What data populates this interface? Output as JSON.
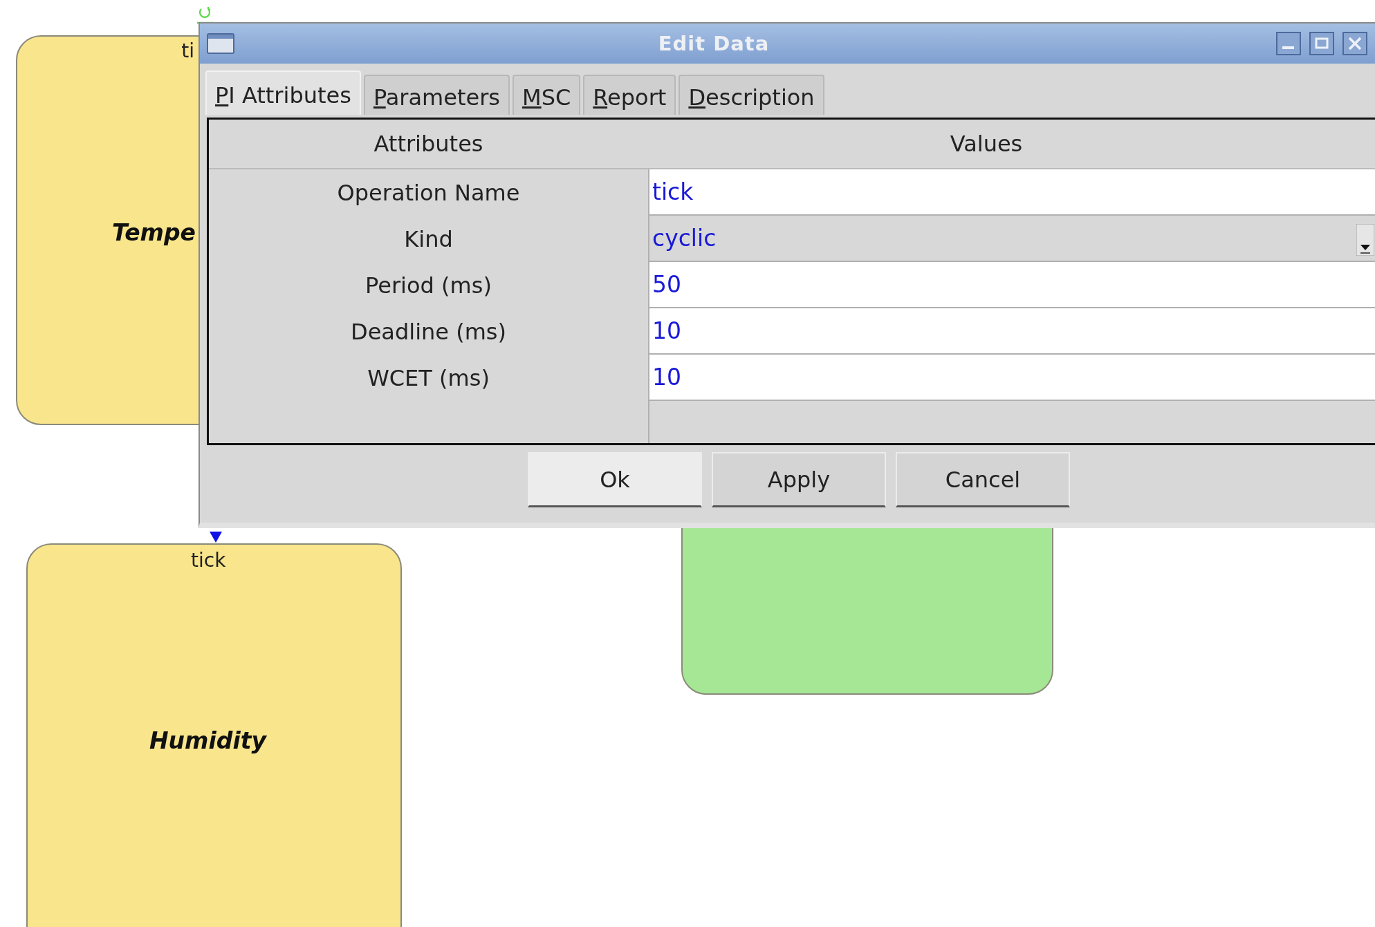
{
  "canvas": {
    "nodes": [
      {
        "name": "Tempe",
        "port": "ti",
        "color": "#f9e58c"
      },
      {
        "name": "Humidity",
        "port": "tick",
        "color": "#f9e58c"
      },
      {
        "color": "#a6e795"
      }
    ]
  },
  "dialog": {
    "title": "Edit Data",
    "tabs": [
      {
        "label": "PI Attributes",
        "selected": true
      },
      {
        "label": "Parameters",
        "selected": false
      },
      {
        "label": "MSC",
        "selected": false
      },
      {
        "label": "Report",
        "selected": false
      },
      {
        "label": "Description",
        "selected": false
      }
    ],
    "table": {
      "columns": [
        "Attributes",
        "Values"
      ],
      "rows": [
        {
          "attribute": "Operation Name",
          "value": "tick",
          "kind": "text"
        },
        {
          "attribute": "Kind",
          "value": "cyclic",
          "kind": "dropdown"
        },
        {
          "attribute": "Period (ms)",
          "value": "50",
          "kind": "text"
        },
        {
          "attribute": "Deadline (ms)",
          "value": "10",
          "kind": "text"
        },
        {
          "attribute": "WCET (ms)",
          "value": "10",
          "kind": "text"
        }
      ]
    },
    "buttons": [
      {
        "label": "Ok",
        "default": true
      },
      {
        "label": "Apply",
        "default": false
      },
      {
        "label": "Cancel",
        "default": false
      }
    ]
  }
}
